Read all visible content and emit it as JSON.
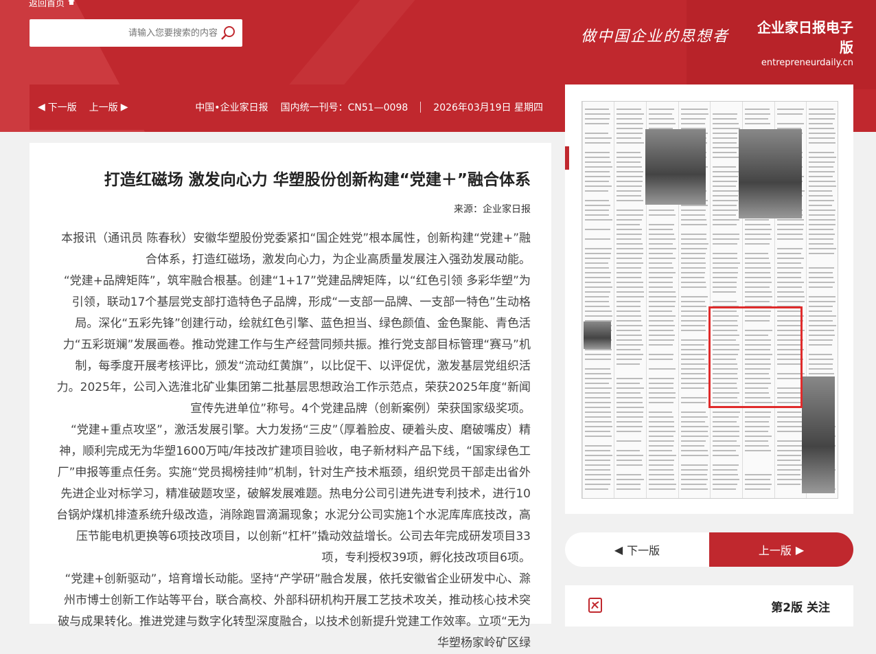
{
  "header": {
    "home_label": "返回首页",
    "search_placeholder": "请输入您要搜索的内容",
    "slogan": "做中国企业的思想者",
    "brand_name": "企业家日报电子版",
    "brand_domain": "entrepreneurdaily.cn"
  },
  "datebar": {
    "date": "2026年03月19日 星期四",
    "issn": "国内统一刊号：CN51—0098",
    "publisher": "中国•企业家日报",
    "prev_label": "上一版",
    "next_label": "下一版"
  },
  "article": {
    "title": "打造红磁场 激发向心力 华塑股份创新构建“党建＋”融合体系",
    "source": "来源：企业家日报",
    "paragraphs": [
      "本报讯（通讯员 陈春秋）安徽华塑股份党委紧扣“国企姓党”根本属性，创新构建“党建+”融合体系，打造红磁场，激发向心力，为企业高质量发展注入强劲发展动能。",
      "“党建+品牌矩阵”，筑牢融合根基。创建“1+17”党建品牌矩阵，以“红色引领 多彩华塑”为引领，联动17个基层党支部打造特色子品牌，形成“一支部一品牌、一支部一特色”生动格局。深化“五彩先锋”创建行动，绘就红色引擎、蓝色担当、绿色颜值、金色聚能、青色活力“五彩斑斓”发展画卷。推动党建工作与生产经营同频共振。推行党支部目标管理“赛马”机制，每季度开展考核评比，颁发“流动红黄旗”，以比促干、以评促优，激发基层党组织活力。2025年，公司入选淮北矿业集团第二批基层思想政治工作示范点，荣获2025年度“新闻宣传先进单位”称号。4个党建品牌（创新案例）荣获国家级奖项。",
      "“党建+重点攻坚”，激活发展引擎。大力发扬“三皮”（厚着脸皮、硬着头皮、磨破嘴皮）精神，顺利完成无为华塑1600万吨/年技改扩建项目验收，电子新材料产品下线，“国家绿色工厂”申报等重点任务。实施“党员揭榜挂帅”机制，针对生产技术瓶颈，组织党员干部走出省外先进企业对标学习，精准破题攻坚，破解发展难题。热电分公司引进先进专利技术，进行10台锅炉煤机排渣系统升级改造，消除跑冒滴漏现象；水泥分公司实施1个水泥库库底技改，高压节能电机更换等6项技改项目，以创新“杠杆”撬动效益增长。公司去年完成研发项目33项，专利授权39项，孵化技改项目6项。",
      "“党建+创新驱动”，培育增长动能。坚持“产学研”融合发展，依托安徽省企业研发中心、滁州市博士创新工作站等平台，联合高校、外部科研机构开展工艺技术攻关，推动核心技术突破与成果转化。推进党建与数字化转型深度融合，以技术创新提升党建工作效率。立项“无为华塑杨家岭矿区绿"
    ]
  },
  "pager": {
    "prev_label": "上一版",
    "next_label": "下一版"
  },
  "edition": {
    "title": "第2版 关注"
  },
  "colors": {
    "brand_red": "#c0282e",
    "highlight_red": "#e02b2b"
  }
}
